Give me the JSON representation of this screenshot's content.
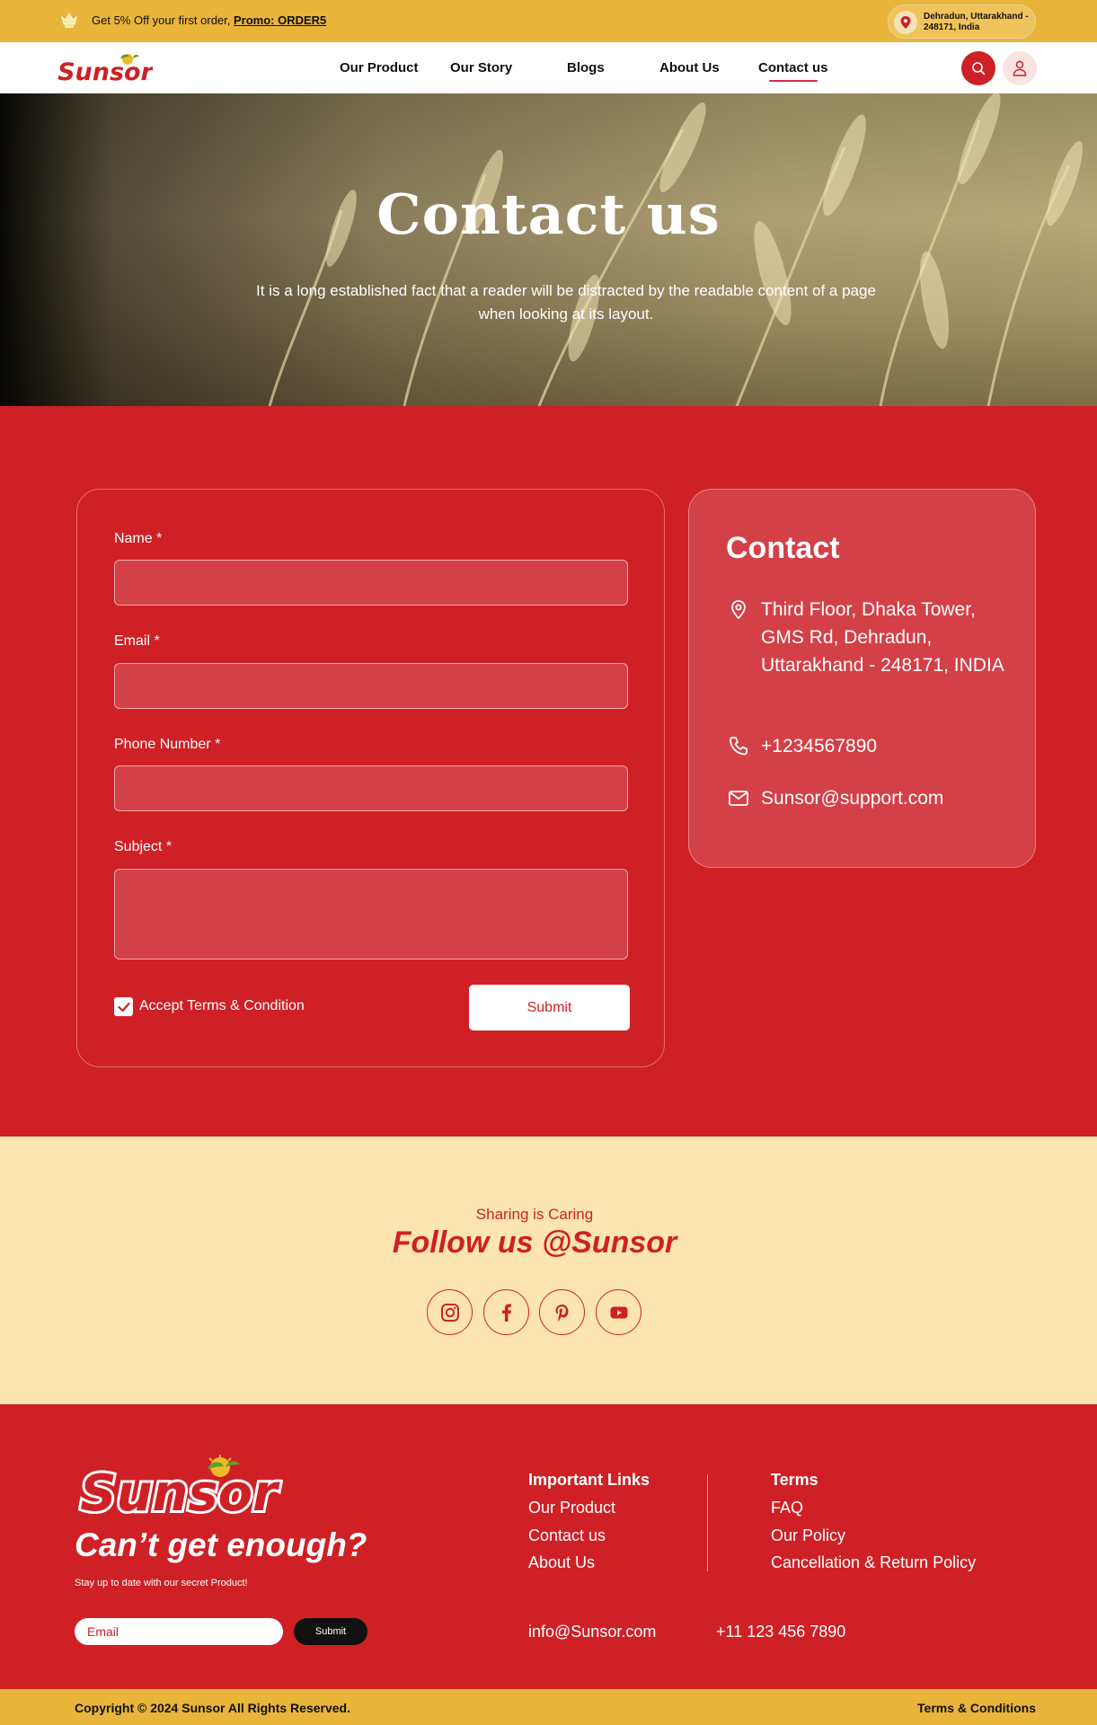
{
  "promo": {
    "text": "Get 5% Off your first order, ",
    "code": "Promo: ORDER5",
    "location": "Dehradun, Uttarakhand - 248171, India"
  },
  "brand": {
    "name": "Sunsor"
  },
  "nav": {
    "items": [
      {
        "label": "Our Product"
      },
      {
        "label": "Our Story"
      },
      {
        "label": "Blogs"
      },
      {
        "label": "About Us"
      },
      {
        "label": "Contact us",
        "active": true
      }
    ]
  },
  "hero": {
    "title": "Contact us",
    "subtitle": "It is a long established fact that a reader will be distracted by the readable content of a page when looking at its layout."
  },
  "form": {
    "fields": [
      {
        "label": "Name *",
        "value": ""
      },
      {
        "label": "Email *",
        "value": ""
      },
      {
        "label": "Phone Number *",
        "value": ""
      },
      {
        "label": "Subject *",
        "value": ""
      }
    ],
    "terms_label": "Accept Terms & Condition",
    "terms_checked": true,
    "submit_label": "Submit"
  },
  "contact": {
    "heading": "Contact",
    "address": "Third Floor, Dhaka Tower, GMS Rd, Dehradun, Uttarakhand - 248171, INDIA",
    "phone": "+1234567890",
    "email": "Sunsor@support.com"
  },
  "follow": {
    "kicker": "Sharing is Caring",
    "title": "Follow us @Sunsor",
    "socials": [
      "instagram-icon",
      "facebook-icon",
      "pinterest-icon",
      "youtube-icon"
    ]
  },
  "footer": {
    "tagline": "Can’t get enough?",
    "sub": "Stay up to date with our secret Product!",
    "email_placeholder": "Email",
    "email_submit": "Submit",
    "important_head": "Important Links",
    "important_links": [
      "Our Product",
      "Contact us",
      "About Us"
    ],
    "terms_head": "Terms",
    "terms_links": [
      "FAQ",
      "Our Policy",
      "Cancellation & Return Policy"
    ],
    "info_email": "info@Sunsor.com",
    "info_phone": "+11 123 456 7890",
    "copyright": "Copyright © 2024 Sunsor   All Rights Reserved.",
    "terms_conditions": "Terms & Conditions"
  },
  "colors": {
    "brand_red": "#cf2025",
    "brand_yellow": "#e8b43a",
    "cream": "#fde5b0"
  }
}
